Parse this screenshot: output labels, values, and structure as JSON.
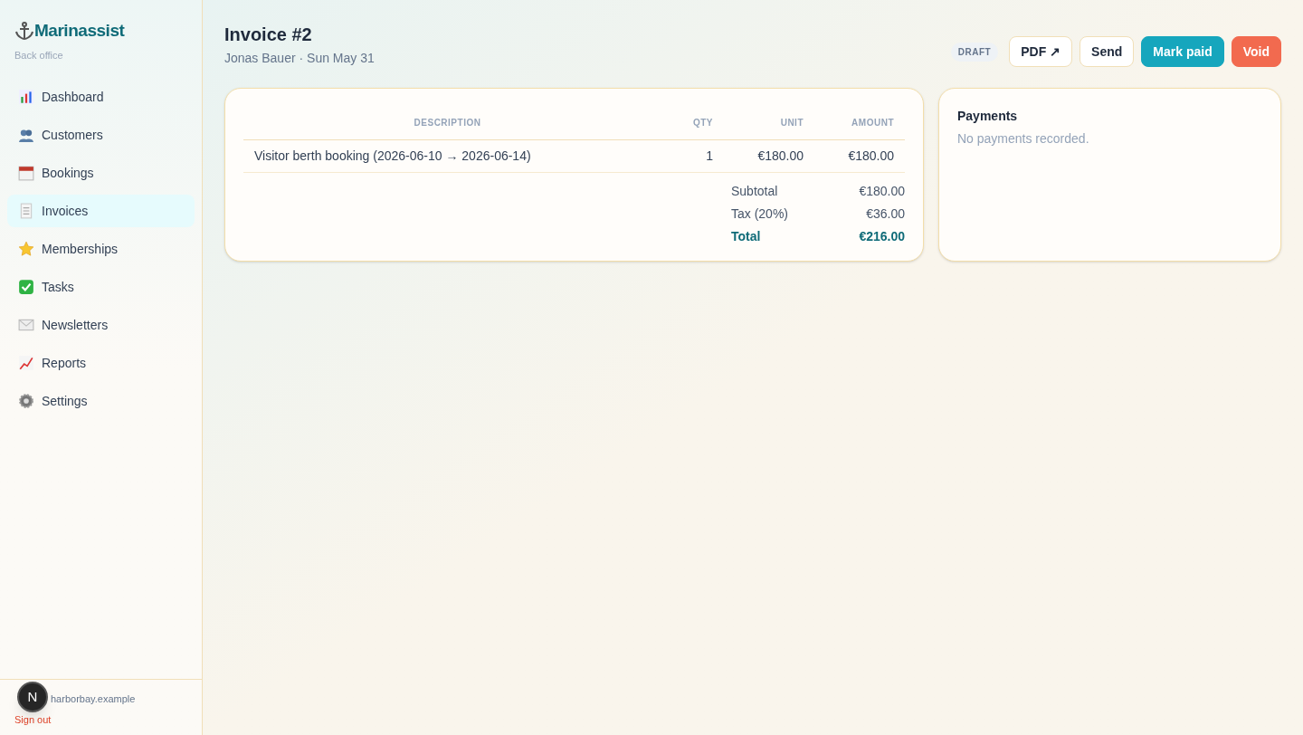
{
  "brand": {
    "name": "Marinassist",
    "subtitle": "Back office"
  },
  "nav": [
    {
      "label": "Dashboard",
      "selected": false
    },
    {
      "label": "Customers",
      "selected": false
    },
    {
      "label": "Bookings",
      "selected": false
    },
    {
      "label": "Invoices",
      "selected": true
    },
    {
      "label": "Memberships",
      "selected": false
    },
    {
      "label": "Tasks",
      "selected": false
    },
    {
      "label": "Newsletters",
      "selected": false
    },
    {
      "label": "Reports",
      "selected": false
    },
    {
      "label": "Settings",
      "selected": false
    }
  ],
  "account": {
    "email": "harborbay.example",
    "sign_out": "Sign out",
    "badge": "N"
  },
  "header": {
    "title": "Invoice #2",
    "subtitle": "Jonas Bauer · Sun May 31",
    "status": "DRAFT"
  },
  "actions": [
    {
      "label": "PDF ↗",
      "kind": "outline"
    },
    {
      "label": "Send",
      "kind": "outline"
    },
    {
      "label": "Mark paid",
      "kind": "primary"
    },
    {
      "label": "Void",
      "kind": "danger"
    }
  ],
  "table": {
    "columns": [
      "DESCRIPTION",
      "QTY",
      "UNIT",
      "AMOUNT"
    ],
    "rows": [
      [
        "Visitor berth booking (2026-06-10 → 2026-06-14)",
        "1",
        "€180.00",
        "€180.00"
      ]
    ],
    "totals": [
      {
        "label": "Subtotal",
        "value": "€180.00",
        "kind": "plain"
      },
      {
        "label": "Tax (20%)",
        "value": "€36.00",
        "kind": "plain"
      },
      {
        "label": "Total",
        "value": "€216.00",
        "kind": "grand"
      }
    ]
  },
  "payments": {
    "title": "Payments",
    "empty": "No payments recorded."
  }
}
